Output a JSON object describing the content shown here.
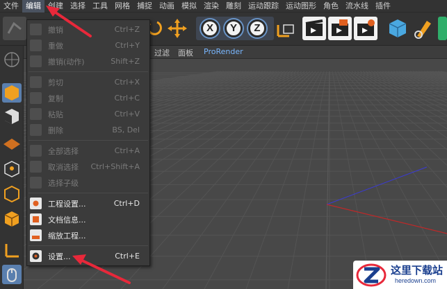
{
  "menubar": {
    "items": [
      "文件",
      "编辑",
      "创建",
      "选择",
      "工具",
      "网格",
      "捕捉",
      "动画",
      "模拟",
      "渲染",
      "雕刻",
      "运动跟踪",
      "运动图形",
      "角色",
      "流水线",
      "插件"
    ],
    "active_index": 1
  },
  "toolbar": {
    "axis_x": "X",
    "axis_y": "Y",
    "axis_z": "Z"
  },
  "viewbar": {
    "filter": "过滤",
    "panel": "面板",
    "prorender": "ProRender"
  },
  "edit_menu": {
    "items": [
      {
        "label": "撤销",
        "shortcut": "Ctrl+Z",
        "enabled": false
      },
      {
        "label": "重做",
        "shortcut": "Ctrl+Y",
        "enabled": false
      },
      {
        "label": "撤销(动作)",
        "shortcut": "Shift+Z",
        "enabled": false
      },
      {
        "label": "剪切",
        "shortcut": "Ctrl+X",
        "enabled": false
      },
      {
        "label": "复制",
        "shortcut": "Ctrl+C",
        "enabled": false
      },
      {
        "label": "粘贴",
        "shortcut": "Ctrl+V",
        "enabled": false
      },
      {
        "label": "删除",
        "shortcut": "BS, Del",
        "enabled": false
      },
      {
        "label": "全部选择",
        "shortcut": "Ctrl+A",
        "enabled": false
      },
      {
        "label": "取消选择",
        "shortcut": "Ctrl+Shift+A",
        "enabled": false
      },
      {
        "label": "选择子级",
        "shortcut": "",
        "enabled": false
      },
      {
        "label": "工程设置...",
        "shortcut": "Ctrl+D",
        "enabled": true
      },
      {
        "label": "文档信息...",
        "shortcut": "",
        "enabled": true
      },
      {
        "label": "缩放工程...",
        "shortcut": "",
        "enabled": true
      },
      {
        "label": "设置...",
        "shortcut": "Ctrl+E",
        "enabled": true
      }
    ]
  },
  "watermark": {
    "title": "这里下载站",
    "url": "heredown.com"
  },
  "colors": {
    "menu_active": "#4a5260",
    "axis_ring": "#6a95c8",
    "arrow": "#e8283a",
    "prorender": "#79b7ff",
    "watermark_blue": "#1a3f8f"
  }
}
